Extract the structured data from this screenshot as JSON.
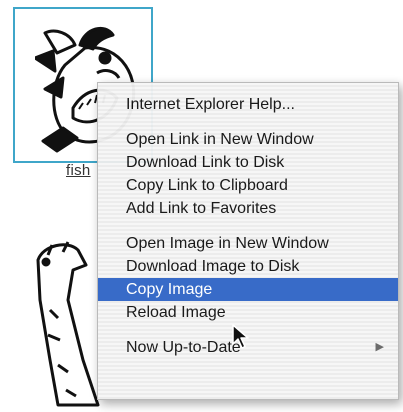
{
  "thumbnail": {
    "caption": "fish"
  },
  "context_menu": {
    "groups": [
      [
        {
          "label": "Internet Explorer Help..."
        }
      ],
      [
        {
          "label": "Open Link in New Window"
        },
        {
          "label": "Download Link to Disk"
        },
        {
          "label": "Copy Link to Clipboard"
        },
        {
          "label": "Add Link to Favorites"
        }
      ],
      [
        {
          "label": "Open Image in New Window"
        },
        {
          "label": "Download Image to Disk"
        },
        {
          "label": "Copy Image",
          "selected": true
        },
        {
          "label": "Reload Image"
        }
      ],
      [
        {
          "label": "Now Up-to-Date",
          "submenu": true
        }
      ]
    ]
  },
  "colors": {
    "selection": "#3066c6",
    "thumbnail_border": "#3fa6c9"
  }
}
